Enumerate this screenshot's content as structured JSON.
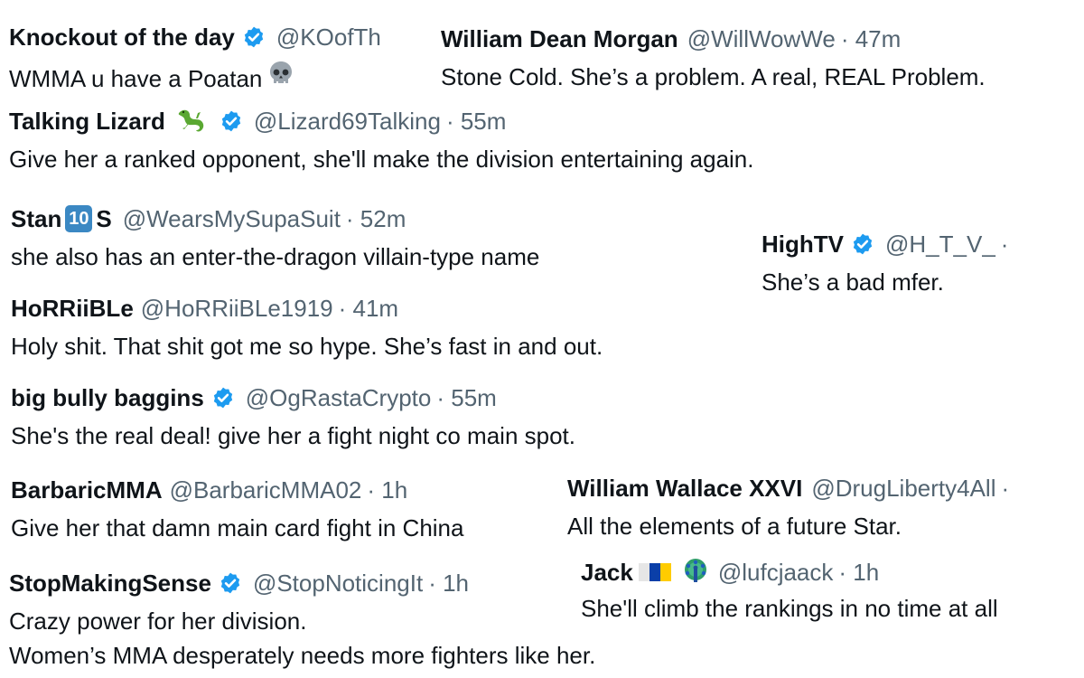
{
  "tweets": [
    {
      "name": "Knockout of the day",
      "handle": "@KOofTh",
      "time": "",
      "text": "WMMA u have a Poatan"
    },
    {
      "name": "William Dean Morgan",
      "handle": "@WillWowWe",
      "time": "· 47m",
      "text": "Stone Cold. She’s a problem. A real, REAL Problem."
    },
    {
      "name": "Talking Lizard",
      "handle": "@Lizard69Talking",
      "time": "· 55m",
      "text": "Give her a ranked opponent, she'll make the division entertaining again."
    },
    {
      "name_a": "Stan",
      "keycap": "10",
      "name_b": "S",
      "handle": "@WearsMySupaSuit",
      "time": "· 52m",
      "text": "she also has an enter-the-dragon villain-type name"
    },
    {
      "name": "HighTV",
      "handle": "@H_T_V_",
      "time": "·",
      "text": "She’s a bad mfer."
    },
    {
      "name": "HoRRiiBLe",
      "handle": "@HoRRiiBLe1919",
      "time": "· 41m",
      "text": "Holy shit. That shit got me so hype. She’s fast in and out."
    },
    {
      "name": "big bully baggins",
      "handle": "@OgRastaCrypto",
      "time": "· 55m",
      "text": "She's the real deal! give her a fight night co main spot."
    },
    {
      "name": "BarbaricMMA",
      "handle": "@BarbaricMMA02",
      "time": "· 1h",
      "text": "Give her that damn main card fight in China"
    },
    {
      "name": "William Wallace XXVI",
      "handle": "@DrugLiberty4All",
      "time": "·",
      "text": "All the elements of a future Star."
    },
    {
      "name": "StopMakingSense",
      "handle": "@StopNoticingIt",
      "time": "· 1h",
      "text_1": "Crazy power for her division.",
      "text_2": "Women’s MMA desperately needs more fighters like her."
    },
    {
      "name": "Jack",
      "handle": "@lufcjaack",
      "time": "· 1h",
      "text": "She'll climb the rankings in no time at all"
    }
  ],
  "icons": {
    "verified_color": "#1d9bf0",
    "skull": "skull-emoji",
    "lizard": "lizard-emoji",
    "keycap": "keycap-ten-emoji",
    "flag": "flag-emoji",
    "peacock": "peacock-emoji"
  }
}
